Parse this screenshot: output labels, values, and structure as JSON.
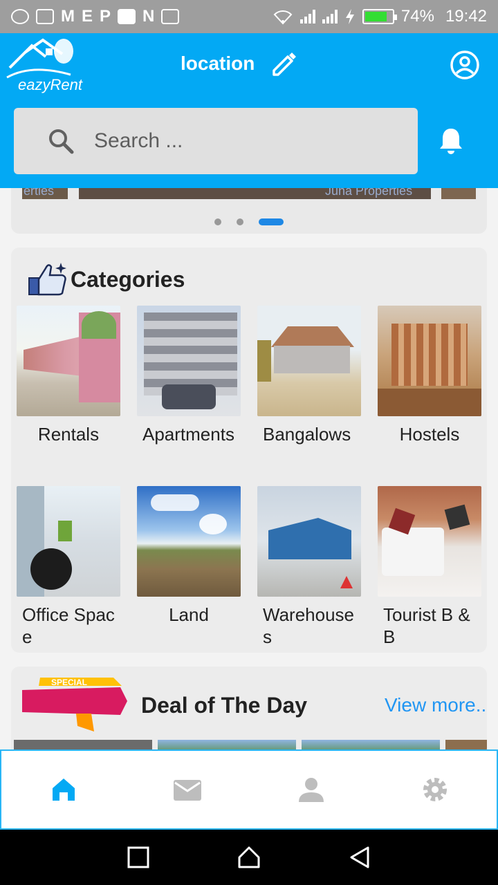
{
  "status_bar": {
    "battery": "74%",
    "time": "19:42",
    "battery_level": 0.74
  },
  "header": {
    "logo_text": "eazyRent",
    "location_label": "location",
    "search_placeholder": "Search ..."
  },
  "carousel": {
    "slide_captions": [
      "erties",
      "Juna Properties"
    ],
    "dot_count": 3,
    "active_dot": 3
  },
  "categories": {
    "title": "Categories",
    "items": [
      {
        "label": "Rentals"
      },
      {
        "label": "Apartments"
      },
      {
        "label": "Bangalows"
      },
      {
        "label": "Hostels"
      },
      {
        "label": "Office Space"
      },
      {
        "label": "Land"
      },
      {
        "label": "Warehouses"
      },
      {
        "label": "Tourist B & B"
      }
    ]
  },
  "deal": {
    "badge": "SPECIAL",
    "title": "Deal of The Day",
    "view_more": "View more.."
  },
  "colors": {
    "primary": "#03a9f4",
    "accent": "#2196f3",
    "badge_red": "#d81b60",
    "badge_yellow": "#ffc107"
  },
  "bottom_nav": [
    {
      "icon": "home-icon",
      "active": true
    },
    {
      "icon": "mail-icon",
      "active": false
    },
    {
      "icon": "person-icon",
      "active": false
    },
    {
      "icon": "settings-icon",
      "active": false
    }
  ]
}
